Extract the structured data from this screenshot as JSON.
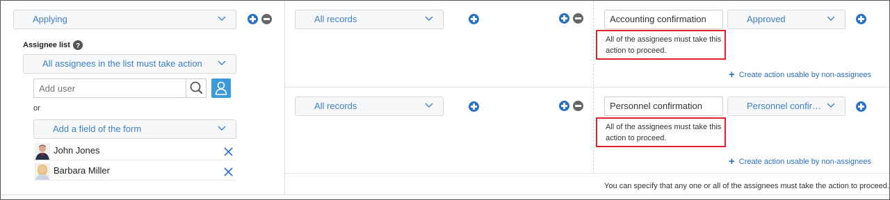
{
  "left_panel": {
    "status_dropdown": "Applying",
    "assignee_list_title": "Assignee list",
    "assignee_mode_dropdown": "All assignees in the list must take action",
    "add_user_placeholder": "Add user",
    "or_label": "or",
    "add_field_dropdown": "Add a field of the form",
    "assignees": [
      {
        "name": "John Jones"
      },
      {
        "name": "Barbara Miller"
      }
    ]
  },
  "rows": [
    {
      "condition_dropdown": "All records",
      "action_name": "Accounting confirmation",
      "destination_dropdown": "Approved",
      "note": "All of the assignees must take this action to proceed.",
      "create_action_link": "Create action usable by non-assignees"
    },
    {
      "condition_dropdown": "All records",
      "action_name": "Personnel confirmation",
      "destination_dropdown": "Personnel confir…",
      "note": "All of the assignees must take this action to proceed.",
      "create_action_link": "Create action usable by non-assignees"
    }
  ],
  "footer_note": "You can specify that any one or all of the assignees must take the action to proceed.",
  "colors": {
    "accent": "#2872c6",
    "dropdown_text": "#3d7fc7",
    "highlight_border": "#e0202a",
    "user_button": "#3b9ad9"
  }
}
